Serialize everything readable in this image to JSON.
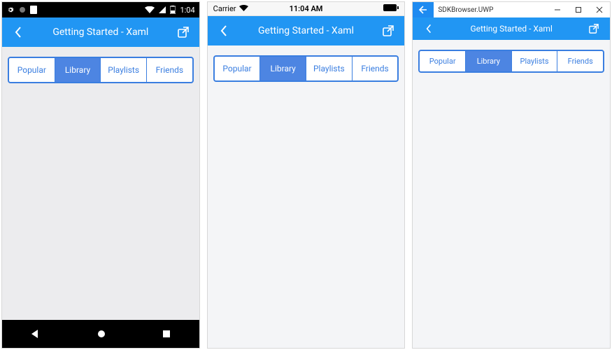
{
  "header": {
    "title": "Getting Started - Xaml"
  },
  "segments": {
    "items": [
      {
        "label": "Popular"
      },
      {
        "label": "Library"
      },
      {
        "label": "Playlists"
      },
      {
        "label": "Friends"
      }
    ],
    "active_index": 1
  },
  "android": {
    "status": {
      "time": "1:04"
    }
  },
  "ios": {
    "status": {
      "carrier": "Carrier",
      "time": "11:04 AM"
    }
  },
  "uwp": {
    "title": "SDKBrowser.UWP"
  }
}
